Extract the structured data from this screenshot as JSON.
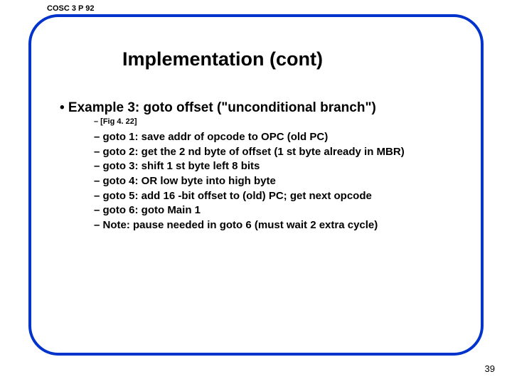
{
  "course_code": "COSC 3 P 92",
  "title": "Implementation (cont)",
  "main_bullet": "•  Example 3: goto offset (\"unconditional branch\")",
  "figure_ref": "–   [Fig 4. 22]",
  "sub_bullets": [
    "–   goto 1: save addr of opcode to OPC (old PC)",
    "–   goto 2: get the 2 nd byte of offset (1 st byte already in MBR)",
    "–   goto 3: shift 1 st byte left 8 bits",
    "–   goto 4: OR low byte into high byte",
    "–   goto 5: add 16 -bit offset to (old) PC; get next opcode",
    "–   goto 6: goto Main 1",
    "–   Note: pause needed in goto 6 (must wait 2 extra cycle)"
  ],
  "page_number": "39"
}
